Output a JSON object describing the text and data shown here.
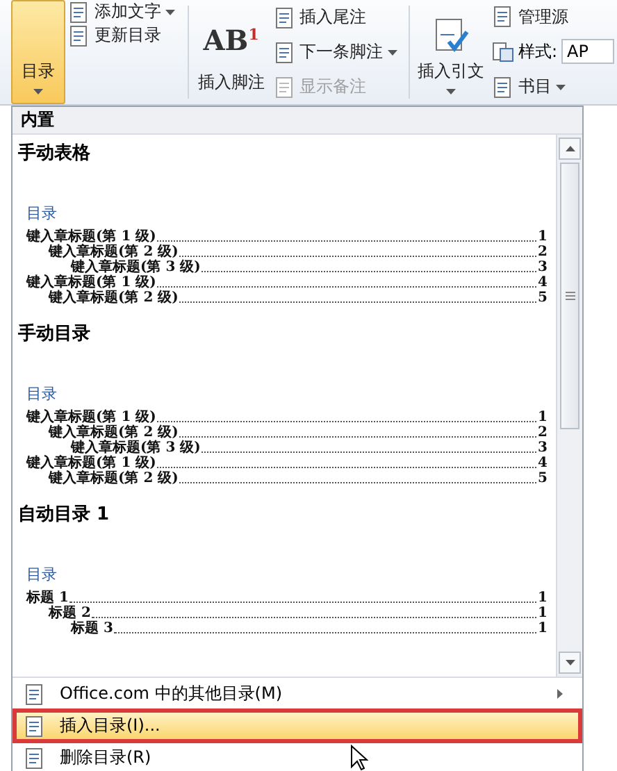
{
  "ribbon": {
    "toc_button": {
      "label": "目录",
      "selected": true
    },
    "toc_small": [
      {
        "label": "添加文字",
        "dropdown": true,
        "disabled": false
      },
      {
        "label": "更新目录",
        "dropdown": false,
        "disabled": false
      }
    ],
    "footnote_button": {
      "label": "插入脚注",
      "icon_text": "AB",
      "icon_sup": "1"
    },
    "footnote_small": [
      {
        "label": "插入尾注",
        "dropdown": false,
        "disabled": false
      },
      {
        "label": "下一条脚注",
        "dropdown": true,
        "disabled": false
      },
      {
        "label": "显示备注",
        "dropdown": false,
        "disabled": true
      }
    ],
    "citation_button": {
      "label": "插入引文",
      "dropdown": true
    },
    "citation_small": [
      {
        "kind": "button",
        "label": "管理源",
        "dropdown": false
      },
      {
        "kind": "field",
        "label": "样式:",
        "value": "AP"
      },
      {
        "kind": "button",
        "label": "书目",
        "dropdown": true
      }
    ]
  },
  "menu": {
    "header": "内置",
    "gallery": [
      {
        "title": "手动表格",
        "heading": "目录",
        "entries": [
          {
            "text": "键入章标题(第 1 级)",
            "page": "1",
            "children": [
              {
                "text": "键入章标题(第 2 级)",
                "page": "2",
                "children": [
                  {
                    "text": "键入章标题(第 3 级)",
                    "page": "3"
                  }
                ]
              }
            ]
          },
          {
            "text": "键入章标题(第 1 级)",
            "page": "4",
            "children": [
              {
                "text": "键入章标题(第 2 级)",
                "page": "5"
              }
            ]
          }
        ]
      },
      {
        "title": "手动目录",
        "heading": "目录",
        "entries": [
          {
            "text": "键入章标题(第 1 级)",
            "page": "1",
            "children": [
              {
                "text": "键入章标题(第 2 级)",
                "page": "2",
                "children": [
                  {
                    "text": "键入章标题(第 3 级)",
                    "page": "3"
                  }
                ]
              }
            ]
          },
          {
            "text": "键入章标题(第 1 级)",
            "page": "4",
            "children": [
              {
                "text": "键入章标题(第 2 级)",
                "page": "5"
              }
            ]
          }
        ]
      },
      {
        "title": "自动目录 1",
        "heading": "目录",
        "entries": [
          {
            "text": "标题 1",
            "page": "1",
            "children": [
              {
                "text": "标题 2",
                "page": "1",
                "children": [
                  {
                    "text": "标题 3",
                    "page": "1"
                  }
                ]
              }
            ]
          }
        ]
      }
    ],
    "items": [
      {
        "label": "Office.com 中的其他目录(M)",
        "submenu": true,
        "selected": false,
        "annotated": false
      },
      {
        "label": "插入目录(I)...",
        "submenu": false,
        "selected": true,
        "annotated": true
      },
      {
        "label": "删除目录(R)",
        "submenu": false,
        "selected": false,
        "annotated": false
      }
    ]
  }
}
